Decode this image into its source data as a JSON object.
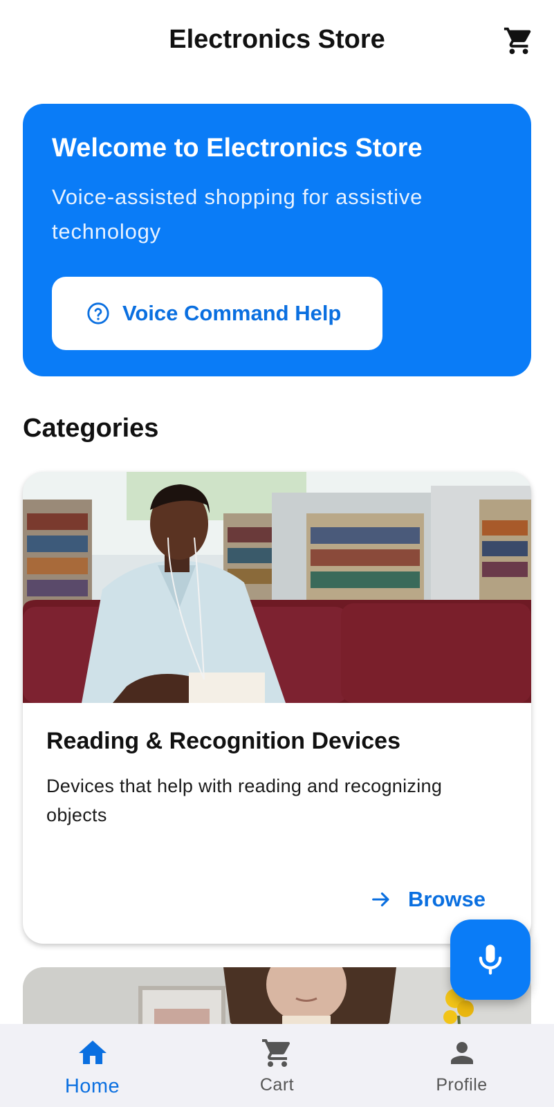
{
  "app_bar": {
    "title": "Electronics Store",
    "cart_icon": "shopping-cart-icon"
  },
  "hero": {
    "title": "Welcome to Electronics Store",
    "subtitle": "Voice-assisted shopping for assistive technology",
    "help_button": {
      "label": "Voice Command Help",
      "icon": "help-circle-icon"
    },
    "background_color": "#0a7cf7"
  },
  "categories": {
    "heading": "Categories",
    "items": [
      {
        "title": "Reading & Recognition Devices",
        "description": "Devices that help with reading and recognizing objects",
        "image": "man-reading-in-library-photo",
        "action_label": "Browse",
        "action_icon": "arrow-right-icon"
      },
      {
        "image": "woman-portrait-photo"
      }
    ]
  },
  "fab": {
    "icon": "microphone-icon"
  },
  "bottom_nav": {
    "items": [
      {
        "label": "Home",
        "icon": "home-icon",
        "active": true
      },
      {
        "label": "Cart",
        "icon": "shopping-cart-icon",
        "active": false
      },
      {
        "label": "Profile",
        "icon": "person-icon",
        "active": false
      }
    ]
  },
  "colors": {
    "accent": "#0a7cf7",
    "text_accent": "#0a6fe0",
    "nav_background": "#f1f1f6"
  }
}
